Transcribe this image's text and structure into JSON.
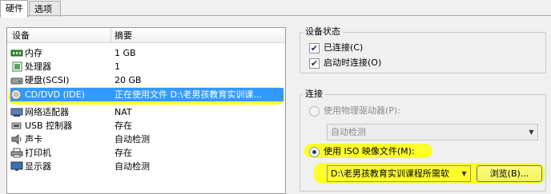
{
  "tabs": [
    {
      "label": "硬件"
    },
    {
      "label": "选项"
    }
  ],
  "device_list": {
    "columns": {
      "device": "设备",
      "summary": "摘要"
    },
    "rows": [
      {
        "icon": "memory-icon",
        "name": "内存",
        "summary": "1 GB"
      },
      {
        "icon": "processor-icon",
        "name": "处理器",
        "summary": "1"
      },
      {
        "icon": "hard-disk-icon",
        "name": "硬盘(SCSI)",
        "summary": "20 GB"
      },
      {
        "icon": "cd-dvd-icon",
        "name": "CD/DVD (IDE)",
        "summary": "正在使用文件 D:\\老男孩教育实训课...",
        "selected": true
      },
      {
        "icon": "network-adapter-icon",
        "name": "网络适配器",
        "summary": "NAT"
      },
      {
        "icon": "usb-icon",
        "name": "USB 控制器",
        "summary": "存在"
      },
      {
        "icon": "sound-card-icon",
        "name": "声卡",
        "summary": "自动检测"
      },
      {
        "icon": "printer-icon",
        "name": "打印机",
        "summary": "存在"
      },
      {
        "icon": "display-icon",
        "name": "显示器",
        "summary": "自动检测"
      }
    ]
  },
  "device_status": {
    "title": "设备状态",
    "connected": {
      "label": "已连接(C)",
      "checked": true
    },
    "connect_at_power_on": {
      "label": "启动时连接(O)",
      "checked": true
    }
  },
  "connection": {
    "title": "连接",
    "physical_drive": {
      "label": "使用物理驱动器(P):",
      "selected": false,
      "disabled": true
    },
    "physical_drive_combo": {
      "value": "自动检测"
    },
    "iso_image": {
      "label": "使用 ISO 映像文件(M):",
      "selected": true
    },
    "iso_path_combo": {
      "value": "D:\\老男孩教育实训课程所需软"
    },
    "browse_button": {
      "label": "浏览(B)..."
    }
  },
  "colors": {
    "selection": "#3399ff",
    "highlighter": "#ffff00",
    "window_bg": "#f0f0f0"
  }
}
